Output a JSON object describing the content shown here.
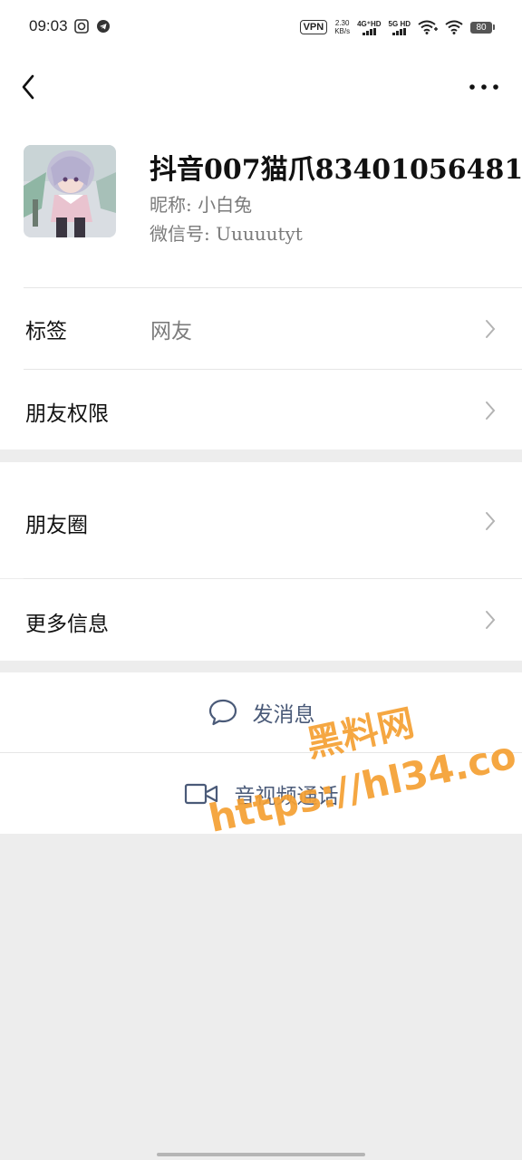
{
  "status_bar": {
    "time": "09:03",
    "vpn": "VPN",
    "speed_value": "2.30",
    "speed_unit": "KB/s",
    "net1": "4G⁺HD",
    "net2": "5G HD",
    "battery": "80"
  },
  "header": {
    "back_icon": "chevron-left-icon",
    "more_icon": "more-dots-icon"
  },
  "profile": {
    "name": "抖音007猫爪83401056481",
    "nickname": "昵称: 小白兔",
    "wechat_id": "微信号: Uuuuutyt"
  },
  "rows": {
    "tags_label": "标签",
    "tags_value": "网友",
    "permissions_label": "朋友权限",
    "moments_label": "朋友圈",
    "more_info_label": "更多信息"
  },
  "actions": {
    "message_label": "发消息",
    "video_call_label": "音视频通话"
  },
  "watermark": {
    "line1": "黑料网",
    "line2": "https://hl34.co"
  },
  "colors": {
    "accent": "#4a5a78",
    "background": "#ededed",
    "watermark": "#f5a032"
  }
}
